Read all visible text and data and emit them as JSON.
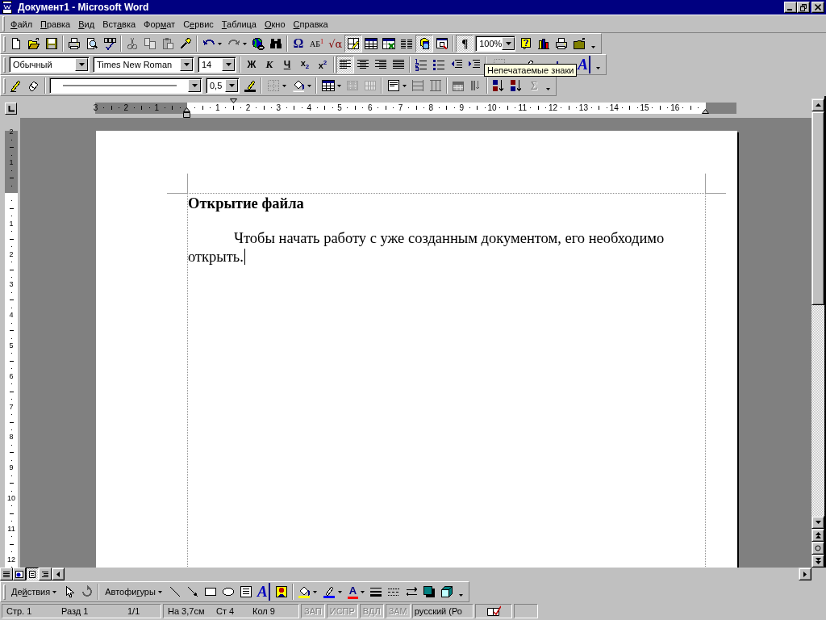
{
  "window": {
    "title": "Документ1 - Microsoft Word"
  },
  "menu": [
    {
      "key": "Ф",
      "post": "айл"
    },
    {
      "key": "П",
      "post": "равка"
    },
    {
      "key": "В",
      "post": "ид"
    },
    {
      "pre": "Вст",
      "key": "а",
      "post": "вка"
    },
    {
      "pre": "Фор",
      "key": "м",
      "post": "ат"
    },
    {
      "pre": "С",
      "key": "е",
      "post": "рвис"
    },
    {
      "key": "Т",
      "post": "аблица"
    },
    {
      "key": "О",
      "post": "кно"
    },
    {
      "key": "С",
      "post": "правка"
    }
  ],
  "standard_toolbar": [
    {
      "kind": "button",
      "pressed": false,
      "disabled": false
    },
    {
      "kind": "button",
      "pressed": false,
      "disabled": false
    },
    {
      "kind": "button",
      "pressed": false,
      "disabled": false
    },
    {
      "kind": "sep"
    },
    {
      "kind": "button",
      "pressed": false,
      "disabled": false
    },
    {
      "kind": "button",
      "pressed": false,
      "disabled": false
    },
    {
      "kind": "button",
      "pressed": false,
      "disabled": false
    },
    {
      "kind": "sep"
    },
    {
      "kind": "button",
      "pressed": false,
      "disabled": true
    },
    {
      "kind": "button",
      "pressed": false,
      "disabled": true
    },
    {
      "kind": "button",
      "pressed": false,
      "disabled": true
    },
    {
      "kind": "button",
      "pressed": false,
      "disabled": false
    },
    {
      "kind": "sep"
    },
    {
      "kind": "split",
      "pressed": false,
      "disabled": false
    },
    {
      "kind": "split",
      "pressed": false,
      "disabled": true
    },
    {
      "kind": "button",
      "pressed": false,
      "disabled": false
    },
    {
      "kind": "button",
      "pressed": false,
      "disabled": false
    },
    {
      "kind": "sep"
    },
    {
      "kind": "glyph",
      "label": "Ω",
      "pressed": false,
      "disabled": false
    },
    {
      "kind": "glyph",
      "label": "АБ$^{1}$",
      "pressed": false,
      "disabled": false
    },
    {
      "kind": "glyph",
      "label": "√α",
      "pressed": false,
      "disabled": false
    },
    {
      "kind": "button",
      "pressed": true,
      "disabled": false
    },
    {
      "kind": "button",
      "pressed": false,
      "disabled": false
    },
    {
      "kind": "button",
      "pressed": false,
      "disabled": false
    },
    {
      "kind": "button",
      "pressed": false,
      "disabled": false
    },
    {
      "kind": "button",
      "pressed": true,
      "disabled": false
    },
    {
      "kind": "button",
      "pressed": false,
      "disabled": false
    },
    {
      "kind": "sep"
    },
    {
      "kind": "glyph",
      "label": "¶",
      "pressed": true,
      "disabled": false
    },
    {
      "kind": "combo",
      "value": "100%"
    },
    {
      "kind": "button",
      "pressed": false,
      "disabled": false
    },
    {
      "kind": "button",
      "pressed": false,
      "disabled": false
    },
    {
      "kind": "button",
      "pressed": false,
      "disabled": false
    },
    {
      "kind": "button",
      "pressed": false,
      "disabled": false
    },
    {
      "kind": "chevron"
    }
  ],
  "formatting_toolbar": [
    {
      "kind": "combo",
      "value": "Обычный"
    },
    {
      "kind": "combo",
      "value": "Times New Roman"
    },
    {
      "kind": "combo",
      "value": "14"
    },
    {
      "kind": "sep"
    },
    {
      "kind": "glyph",
      "label": "Ж",
      "pressed": false,
      "disabled": false
    },
    {
      "kind": "glyph",
      "label": "К",
      "pressed": false,
      "disabled": false
    },
    {
      "kind": "glyph",
      "label": "Ч",
      "pressed": false,
      "disabled": false
    },
    {
      "kind": "glyph",
      "label": "x$_{2}$",
      "pressed": false,
      "disabled": false
    },
    {
      "kind": "glyph",
      "label": "x$^{2}$",
      "pressed": false,
      "disabled": false
    },
    {
      "kind": "sep"
    },
    {
      "kind": "button",
      "pressed": true,
      "disabled": false
    },
    {
      "kind": "button",
      "pressed": false,
      "disabled": false
    },
    {
      "kind": "button",
      "pressed": false,
      "disabled": false
    },
    {
      "kind": "button",
      "pressed": false,
      "disabled": false
    },
    {
      "kind": "sep"
    },
    {
      "kind": "button",
      "pressed": false,
      "disabled": false
    },
    {
      "kind": "button",
      "pressed": false,
      "disabled": false
    },
    {
      "kind": "button",
      "pressed": false,
      "disabled": false
    },
    {
      "kind": "button",
      "pressed": false,
      "disabled": false
    },
    {
      "kind": "sep"
    },
    {
      "kind": "split",
      "pressed": false,
      "disabled": false
    },
    {
      "kind": "split",
      "pressed": false,
      "disabled": false
    },
    {
      "kind": "split",
      "pressed": false,
      "disabled": false
    },
    {
      "kind": "glyph",
      "label": "A",
      "pressed": false,
      "disabled": false
    },
    {
      "kind": "chevron"
    }
  ],
  "tooltip": "Непечатаемые знаки",
  "tables_toolbar": [
    {
      "kind": "button",
      "pressed": false,
      "disabled": false
    },
    {
      "kind": "button",
      "pressed": false,
      "disabled": false
    },
    {
      "kind": "sep"
    },
    {
      "kind": "line_combo"
    },
    {
      "kind": "combo",
      "value": "0,5"
    },
    {
      "kind": "button",
      "pressed": false,
      "disabled": false
    },
    {
      "kind": "sep"
    },
    {
      "kind": "split",
      "pressed": false,
      "disabled": false
    },
    {
      "kind": "split",
      "pressed": false,
      "disabled": false
    },
    {
      "kind": "sep"
    },
    {
      "kind": "split",
      "pressed": false,
      "disabled": false
    },
    {
      "kind": "button",
      "pressed": false,
      "disabled": true
    },
    {
      "kind": "button",
      "pressed": false,
      "disabled": true
    },
    {
      "kind": "sep"
    },
    {
      "kind": "split",
      "pressed": false,
      "disabled": false
    },
    {
      "kind": "button",
      "pressed": false,
      "disabled": true
    },
    {
      "kind": "button",
      "pressed": false,
      "disabled": true
    },
    {
      "kind": "sep"
    },
    {
      "kind": "button",
      "pressed": false,
      "disabled": true
    },
    {
      "kind": "button",
      "pressed": false,
      "disabled": true
    },
    {
      "kind": "sep"
    },
    {
      "kind": "button",
      "pressed": false,
      "disabled": false
    },
    {
      "kind": "button",
      "pressed": false,
      "disabled": false
    },
    {
      "kind": "glyph",
      "label": "Σ",
      "pressed": false,
      "disabled": true
    },
    {
      "kind": "chevron"
    }
  ],
  "ruler": {
    "left_numbers": [
      "3",
      "2",
      "1"
    ],
    "numbers": [
      "1",
      "2",
      "3",
      "4",
      "5",
      "6",
      "7",
      "8",
      "9",
      "10",
      "11",
      "12",
      "13",
      "14",
      "15",
      "16"
    ]
  },
  "vertical_ruler": {
    "top_numbers": [
      "2",
      "1"
    ],
    "numbers": [
      "1",
      "2",
      "3",
      "4",
      "5",
      "6",
      "7",
      "8",
      "9",
      "10",
      "11",
      "12"
    ]
  },
  "document": {
    "heading": "Открытие файла",
    "paragraph": "Чтобы начать работу с уже созданным документом, его необходимо открыть."
  },
  "view_buttons": [
    {
      "selected": false
    },
    {
      "selected": false
    },
    {
      "selected": true
    },
    {
      "selected": false
    }
  ],
  "drawing_toolbar": [
    {
      "kind": "menu",
      "pre": "Де",
      "key": "й",
      "post": "ствия"
    },
    {
      "kind": "button",
      "pressed": false,
      "disabled": false
    },
    {
      "kind": "button",
      "pressed": false,
      "disabled": true
    },
    {
      "kind": "sep"
    },
    {
      "kind": "menu",
      "pre": "Автофи",
      "key": "г",
      "post": "уры"
    },
    {
      "kind": "button",
      "pressed": false,
      "disabled": false
    },
    {
      "kind": "button",
      "pressed": false,
      "disabled": false
    },
    {
      "kind": "button",
      "pressed": false,
      "disabled": false
    },
    {
      "kind": "button",
      "pressed": false,
      "disabled": false
    },
    {
      "kind": "button",
      "pressed": false,
      "disabled": false
    },
    {
      "kind": "glyph",
      "label": "A",
      "pressed": false,
      "disabled": false
    },
    {
      "kind": "button",
      "pressed": false,
      "disabled": false
    },
    {
      "kind": "sep"
    },
    {
      "kind": "split",
      "pressed": false,
      "disabled": false
    },
    {
      "kind": "split",
      "pressed": false,
      "disabled": false
    },
    {
      "kind": "glyph_split",
      "label": "A",
      "pressed": false,
      "disabled": false
    },
    {
      "kind": "button",
      "pressed": false,
      "disabled": false
    },
    {
      "kind": "button",
      "pressed": false,
      "disabled": false
    },
    {
      "kind": "button",
      "pressed": false,
      "disabled": false
    },
    {
      "kind": "button",
      "pressed": false,
      "disabled": false
    },
    {
      "kind": "button",
      "pressed": false,
      "disabled": false
    },
    {
      "kind": "chevron"
    }
  ],
  "status_bar": {
    "page": "Стр. 1",
    "section": "Разд 1",
    "pages": "1/1",
    "position": "На 3,7см",
    "line": "Ст 4",
    "column": "Кол 9",
    "modes": [
      {
        "label": "ЗАП",
        "disabled": true
      },
      {
        "label": "ИСПР",
        "disabled": true
      },
      {
        "label": "ВДЛ",
        "disabled": true
      },
      {
        "label": "ЗАМ",
        "disabled": true
      }
    ],
    "language": "русский (Ро"
  }
}
